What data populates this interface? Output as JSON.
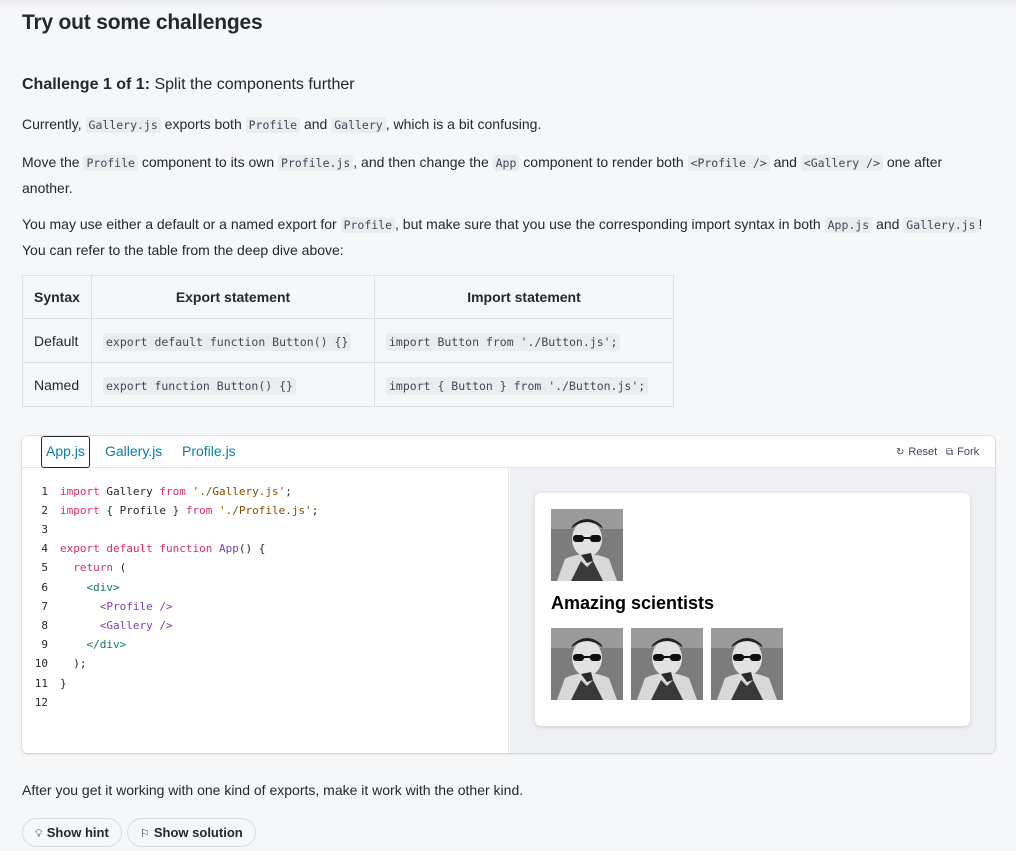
{
  "heading": "Try out some challenges",
  "challenge": {
    "label": "Challenge 1 of 1:",
    "title": "Split the components further"
  },
  "p1": {
    "t1": "Currently, ",
    "c1": "Gallery.js",
    "t2": " exports both ",
    "c2": "Profile",
    "t3": " and ",
    "c3": "Gallery",
    "t4": ", which is a bit confusing."
  },
  "p2": {
    "t1": "Move the ",
    "c1": "Profile",
    "t2": " component to its own ",
    "c2": "Profile.js",
    "t3": ", and then change the ",
    "c3": "App",
    "t4": " component to render both ",
    "c4": "<Profile />",
    "t5": " and ",
    "c5": "<Gallery />",
    "t6": " one after another."
  },
  "p3": {
    "t1": "You may use either a default or a named export for ",
    "c1": "Profile",
    "t2": ", but make sure that you use the corresponding import syntax in both ",
    "c2": "App.js",
    "t3": " and ",
    "c3": "Gallery.js",
    "t4": "! You can refer to the table from the deep dive above:"
  },
  "table": {
    "headers": [
      "Syntax",
      "Export statement",
      "Import statement"
    ],
    "rows": [
      [
        "Default",
        "export default function Button() {}",
        "import Button from './Button.js';"
      ],
      [
        "Named",
        "export function Button() {}",
        "import { Button } from './Button.js';"
      ]
    ]
  },
  "sandbox": {
    "tabs": [
      "App.js",
      "Gallery.js",
      "Profile.js"
    ],
    "reset_label": "Reset",
    "fork_label": "Fork",
    "line_numbers": [
      "1",
      "2",
      "3",
      "4",
      "5",
      "6",
      "7",
      "8",
      "9",
      "10",
      "11",
      "12"
    ],
    "preview_heading": "Amazing scientists"
  },
  "footer_text": "After you get it working with one kind of exports, make it work with the other kind.",
  "buttons": {
    "hint": "Show hint",
    "solution": "Show solution"
  },
  "colors": {
    "link": "#087ea4",
    "keyword": "#d6325f",
    "string": "#8a4a00",
    "function": "#7a3eaf",
    "tag": "#14795a"
  }
}
